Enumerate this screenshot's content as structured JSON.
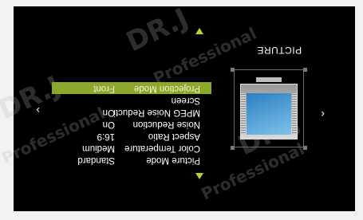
{
  "menu": {
    "title": "PICTURE",
    "rows": [
      {
        "label": "Picture Mode",
        "value": "Standard",
        "selected": false
      },
      {
        "label": "Color Temperature",
        "value": "Medium",
        "selected": false
      },
      {
        "label": "Aspect Ratio",
        "value": "16:9",
        "selected": false
      },
      {
        "label": "Noise Reduction",
        "value": "On",
        "selected": false
      },
      {
        "label": "MPEG  Noise Reducti",
        "value": "On",
        "selected": false
      },
      {
        "label": "Screen",
        "value": "",
        "selected": false
      },
      {
        "label": "Projection Mode",
        "value": "Front",
        "selected": true
      }
    ]
  },
  "colors": {
    "accent": "#8ba82b",
    "arrow": "#b6d33a",
    "background": "#000000"
  },
  "icons": {
    "up": "triangle-up-icon",
    "down": "triangle-down-icon",
    "left": "chevron-left-icon",
    "right": "chevron-right-icon",
    "preview": "tv-preview-icon"
  },
  "watermark": {
    "brand": "DR.J",
    "tagline": "Professional"
  }
}
